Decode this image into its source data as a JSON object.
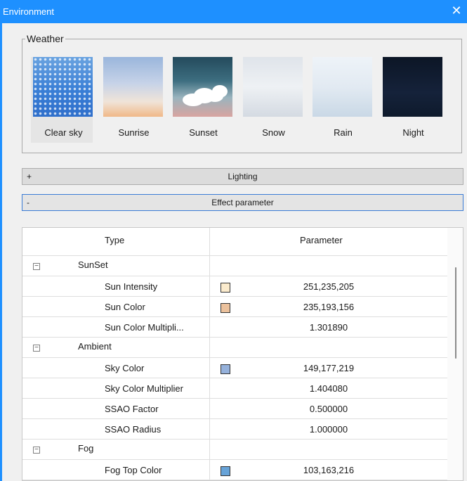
{
  "window": {
    "title": "Environment",
    "close_glyph": "✕"
  },
  "weather": {
    "legend": "Weather",
    "presets": [
      {
        "label": "Clear sky",
        "selected": true,
        "thumb": "clear"
      },
      {
        "label": "Sunrise",
        "thumb": "sunrise"
      },
      {
        "label": "Sunset",
        "thumb": "sunset"
      },
      {
        "label": "Snow",
        "thumb": "snow"
      },
      {
        "label": "Rain",
        "thumb": "rain"
      },
      {
        "label": "Night",
        "thumb": "night"
      }
    ]
  },
  "sections": {
    "lighting": {
      "sign": "+",
      "label": "Lighting"
    },
    "effect": {
      "sign": "-",
      "label": "Effect parameter"
    }
  },
  "grid": {
    "header": {
      "type": "Type",
      "parameter": "Parameter"
    },
    "rows": [
      {
        "kind": "group",
        "label": "SunSet",
        "expander": "−"
      },
      {
        "kind": "prop",
        "label": "Sun Intensity",
        "value": "251,235,205",
        "swatch": "#fbebcd"
      },
      {
        "kind": "prop",
        "label": "Sun Color",
        "value": "235,193,156",
        "swatch": "#ebc19c"
      },
      {
        "kind": "prop",
        "label": "Sun Color Multipli...",
        "value": "1.301890"
      },
      {
        "kind": "group",
        "label": "Ambient",
        "expander": "−"
      },
      {
        "kind": "prop",
        "label": "Sky Color",
        "value": "149,177,219",
        "swatch": "#95b1db"
      },
      {
        "kind": "prop",
        "label": "Sky Color Multiplier",
        "value": "1.404080"
      },
      {
        "kind": "prop",
        "label": "SSAO Factor",
        "value": "0.500000"
      },
      {
        "kind": "prop",
        "label": "SSAO Radius",
        "value": "1.000000"
      },
      {
        "kind": "group",
        "label": "Fog",
        "expander": "−"
      },
      {
        "kind": "prop",
        "label": "Fog Top Color",
        "value": "103,163,216",
        "swatch": "#67a3d8"
      }
    ]
  },
  "colors": {
    "titlebar": "#1e90ff",
    "section_active_border": "#3a7bd5"
  }
}
